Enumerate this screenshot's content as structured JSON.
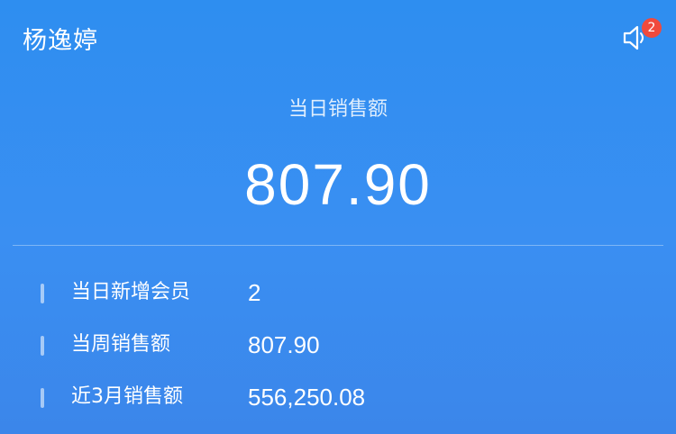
{
  "header": {
    "user_name": "杨逸婷",
    "notification_icon": "speaker-icon",
    "notification_count": "2"
  },
  "summary": {
    "label": "当日销售额",
    "value": "807.90"
  },
  "stats": [
    {
      "label": "当日新增会员",
      "value": "2"
    },
    {
      "label": "当周销售额",
      "value": "807.90"
    },
    {
      "label": "近3月销售额",
      "value": "556,250.08"
    }
  ],
  "colors": {
    "background": "#3a8ff2",
    "badge": "#f04a3c",
    "text": "#ffffff"
  }
}
